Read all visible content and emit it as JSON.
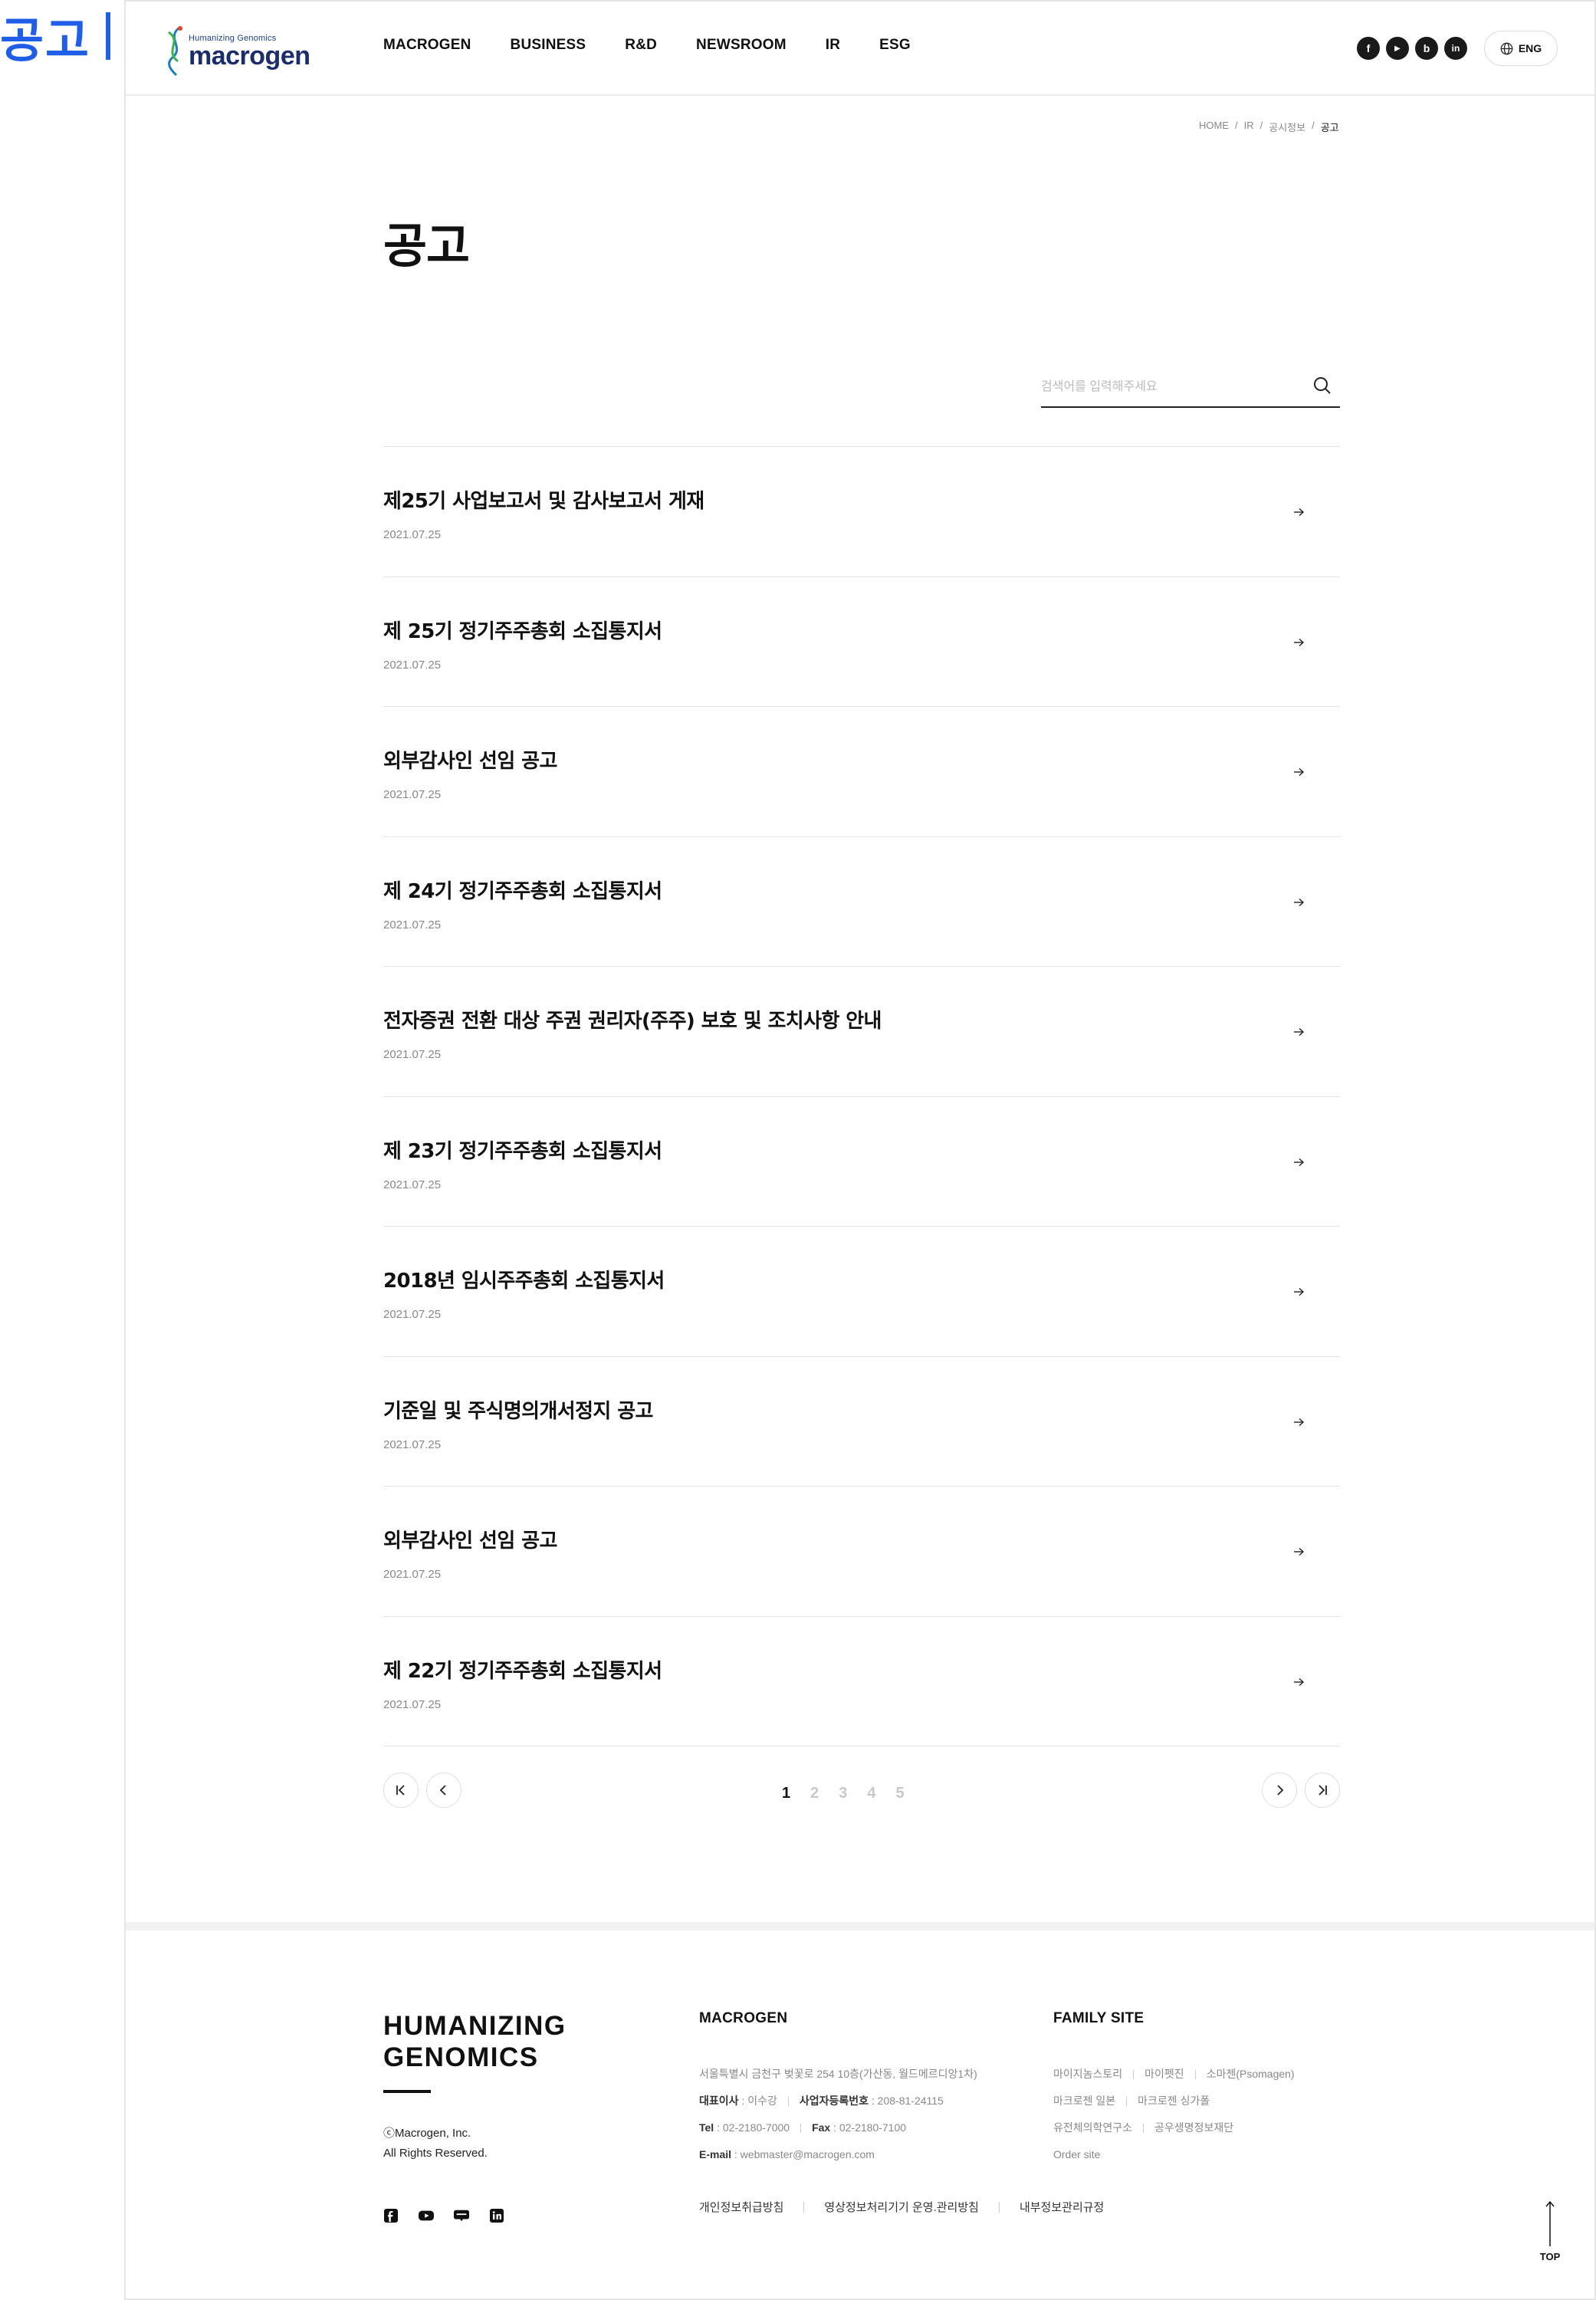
{
  "side_label": "공고",
  "header": {
    "logo_tagline": "Humanizing Genomics",
    "logo_word": "macrogen",
    "nav": [
      "MACROGEN",
      "BUSINESS",
      "R&D",
      "NEWSROOM",
      "IR",
      "ESG"
    ],
    "socials": [
      "f",
      "▶",
      "b",
      "in"
    ],
    "lang": "ENG"
  },
  "breadcrumb": [
    "HOME",
    "IR",
    "공시정보",
    "공고"
  ],
  "page_title": "공고",
  "search": {
    "placeholder": "검색어를 입력해주세요"
  },
  "notices": [
    {
      "title": "제25기 사업보고서 및 감사보고서 게재",
      "date": "2021.07.25"
    },
    {
      "title": "제 25기 정기주주총회 소집통지서",
      "date": "2021.07.25"
    },
    {
      "title": "외부감사인 선임 공고",
      "date": "2021.07.25"
    },
    {
      "title": "제 24기 정기주주총회 소집통지서",
      "date": "2021.07.25"
    },
    {
      "title": "전자증권 전환 대상 주권 권리자(주주) 보호 및 조치사항 안내",
      "date": "2021.07.25"
    },
    {
      "title": "제 23기 정기주주총회 소집통지서",
      "date": "2021.07.25"
    },
    {
      "title": "2018년 임시주주총회 소집통지서",
      "date": "2021.07.25"
    },
    {
      "title": "기준일 및 주식명의개서정지 공고",
      "date": "2021.07.25"
    },
    {
      "title": "외부감사인 선임 공고",
      "date": "2021.07.25"
    },
    {
      "title": "제 22기 정기주주총회 소집통지서",
      "date": "2021.07.25"
    }
  ],
  "pagination": {
    "pages": [
      "1",
      "2",
      "3",
      "4",
      "5"
    ],
    "current": "1"
  },
  "footer": {
    "slogan_1": "HUMANIZING",
    "slogan_2": "GENOMICS",
    "copy_1": "ⓒMacrogen, Inc.",
    "copy_2": "All Rights Reserved.",
    "macrogen_heading": "MACROGEN",
    "address": "서울특별시 금천구 벚꽃로 254 10층(가산동, 월드메르디앙1차)",
    "ceo_label": "대표이사",
    "ceo": " : 이수강",
    "biz_label": "사업자등록번호",
    "biz": " : 208-81-24115",
    "tel_label": "Tel",
    "tel": " : 02-2180-7000",
    "fax_label": "Fax",
    "fax": " : 02-2180-7100",
    "email_label": "E-mail",
    "email": " : webmaster@macrogen.com",
    "family_heading": "FAMILY SITE",
    "family": [
      "마이지놈스토리",
      "마이펫진",
      "소마젠(Psomagen)",
      "마크로젠 일본",
      "마크로젠 싱가폴",
      "유전체의학연구소",
      "공우생명정보재단",
      "Order site"
    ],
    "policies": [
      "개인정보취급방침",
      "영상정보처리기기 운영.관리방침",
      "내부정보관리규정"
    ],
    "top_label": "TOP"
  }
}
